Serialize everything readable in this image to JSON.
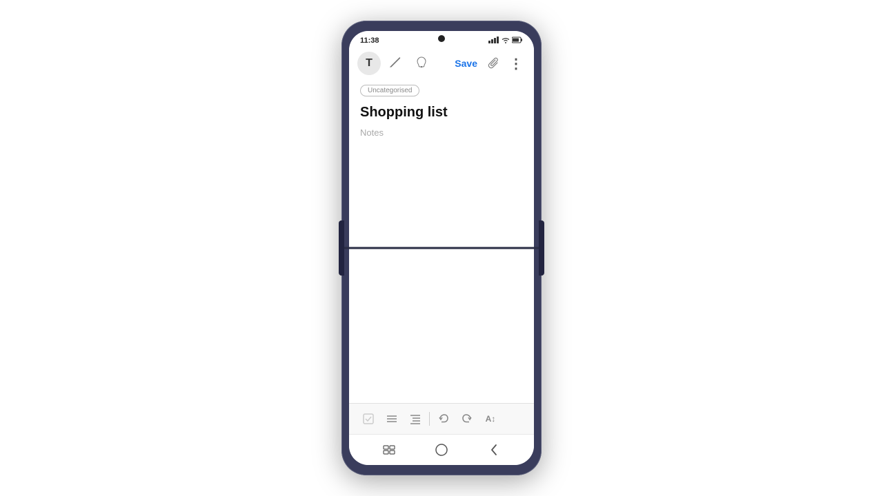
{
  "phone": {
    "status_bar": {
      "time": "11:38",
      "signal_icon": "▌▌▌",
      "wifi_icon": "wifi",
      "battery_icon": "▮"
    },
    "toolbar": {
      "text_tool_icon": "T",
      "pen_tool_icon": "✏",
      "paint_tool_icon": "🎨",
      "save_label": "Save",
      "attach_icon": "📎",
      "more_icon": "⋮"
    },
    "content": {
      "category_badge": "Uncategorised",
      "note_title": "Shopping list",
      "notes_placeholder": "Notes"
    },
    "format_bar": {
      "checkbox_icon": "☑",
      "list_icon": "≡",
      "indent_icon": "≣",
      "divider": "|",
      "undo_icon": "↩",
      "redo_icon": "↪",
      "text_size_icon": "A↕"
    },
    "nav_bar": {
      "recent_icon": "|||",
      "home_icon": "○",
      "back_icon": "‹"
    }
  }
}
